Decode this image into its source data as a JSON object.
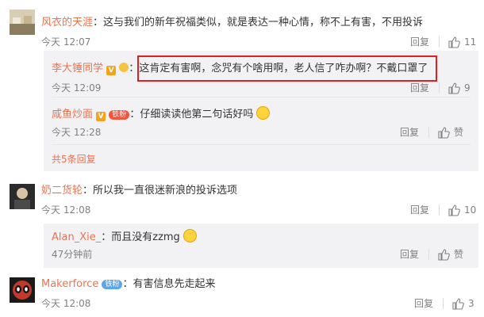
{
  "comments": [
    {
      "user": "风衣的天涯",
      "text": "这与我们的新年祝福类似，就是表达一种心情，称不上有害，不用投诉",
      "time": "今天 12:07",
      "reply_label": "回复",
      "likes": "11"
    },
    {
      "user": "奶二货轮",
      "text": "所以我一直很迷新浪的投诉选项",
      "time": "今天 12:08",
      "reply_label": "回复",
      "likes": "10"
    },
    {
      "user": "Makerforce",
      "badge": "铁粉",
      "text": "有害信息先走起来",
      "time": "今天 12:08",
      "reply_label": "回复",
      "likes": "3"
    }
  ],
  "replies_1": [
    {
      "user": "李大锤同学",
      "text": "这肯定有害啊，念咒有个啥用啊，老人信了咋办啊？不戴口罩了",
      "time": "今天 12:09",
      "reply_label": "回复",
      "likes": "9"
    },
    {
      "user": "咸鱼炒面",
      "badge": "铁粉",
      "text": "仔细读读他第二句话好吗",
      "time": "今天 12:28",
      "reply_label": "回复",
      "likes": ""
    }
  ],
  "more_replies": "共5条回复",
  "replies_2": [
    {
      "user": "Alan_Xie_",
      "text": "而且没有zzmg",
      "time": "47分钟前",
      "reply_label": "回复",
      "likes": ""
    }
  ],
  "colors": {
    "name": "#eb7350",
    "highlight": "#e02020",
    "subbox": "#f2f2f5"
  }
}
